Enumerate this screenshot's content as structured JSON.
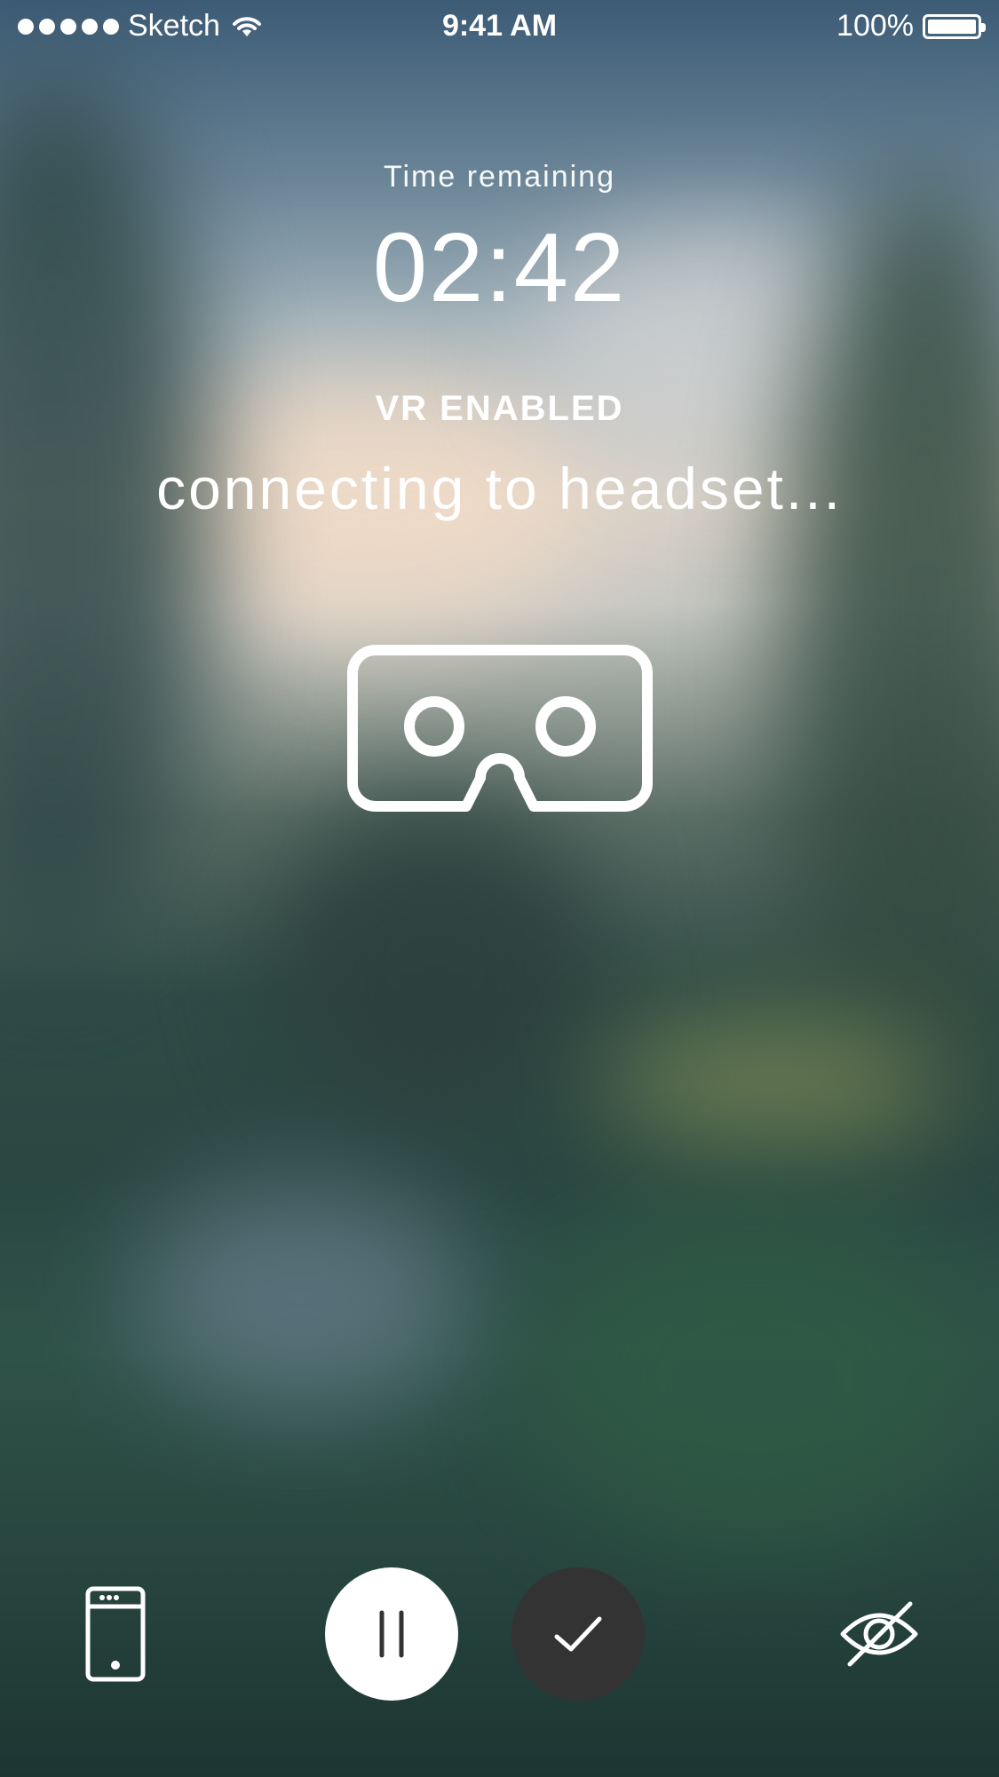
{
  "status_bar": {
    "carrier": "Sketch",
    "time": "9:41 AM",
    "battery": "100%",
    "signal_icon": "signal-dots-icon",
    "wifi_icon": "wifi-icon",
    "battery_icon": "battery-icon"
  },
  "session": {
    "time_label": "Time remaining",
    "time_value": "02:42",
    "vr_status": "VR ENABLED",
    "connection_message": "connecting to headset..."
  },
  "icons": {
    "headset": "vr-headset-icon",
    "phone": "phone-icon",
    "pause": "pause-icon",
    "check": "check-icon",
    "eye_off": "eye-off-icon"
  },
  "colors": {
    "text": "#ffffff",
    "pause_bg": "#ffffff",
    "check_bg": "#333333"
  }
}
